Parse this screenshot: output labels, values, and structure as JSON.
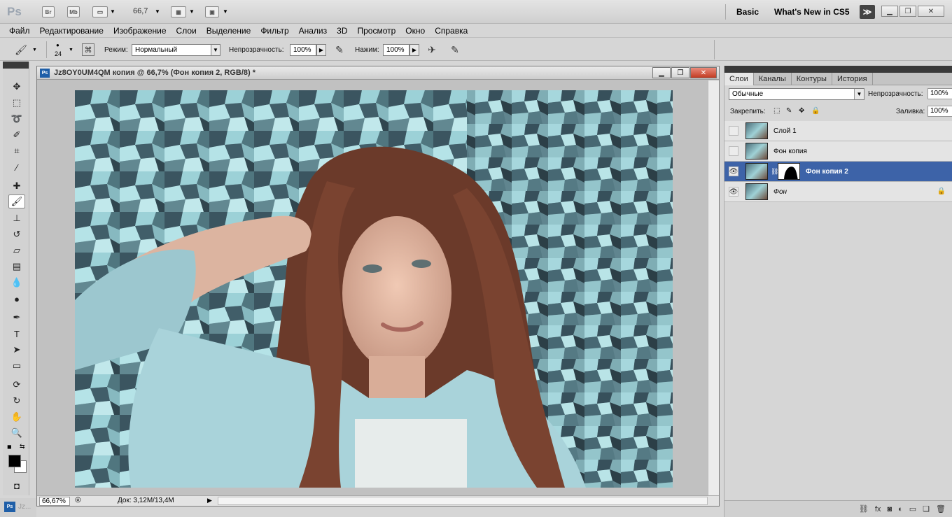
{
  "app": {
    "logo": "Ps",
    "br": "Br",
    "mb": "Mb",
    "zoom": "66,7",
    "workspace_basic": "Basic",
    "workspace_new": "What's New in CS5",
    "more": "≫"
  },
  "menu": [
    "Файл",
    "Редактирование",
    "Изображение",
    "Слои",
    "Выделение",
    "Фильтр",
    "Анализ",
    "3D",
    "Просмотр",
    "Окно",
    "Справка"
  ],
  "options": {
    "brush_size": "24",
    "mode_label": "Режим:",
    "mode_value": "Нормальный",
    "opacity_label": "Непрозрачность:",
    "opacity_value": "100%",
    "flow_label": "Нажим:",
    "flow_value": "100%"
  },
  "document": {
    "title": "Jz8OY0UM4QM копия @ 66,7% (Фон копия 2, RGB/8) *",
    "zoom": "66,67%",
    "doc_info": "Док: 3,12M/13,4M"
  },
  "layers_panel": {
    "tabs": [
      "Слои",
      "Каналы",
      "Контуры",
      "История"
    ],
    "blend_mode": "Обычные",
    "opacity_label": "Непрозрачность:",
    "opacity_value": "100%",
    "lock_label": "Закрепить:",
    "fill_label": "Заливка:",
    "fill_value": "100%",
    "layers": [
      {
        "name": "Слой 1",
        "visible": false,
        "selected": false
      },
      {
        "name": "Фон копия",
        "visible": false,
        "selected": false
      },
      {
        "name": "Фон копия 2",
        "visible": true,
        "selected": true,
        "has_mask": true
      },
      {
        "name": "Фон",
        "visible": true,
        "selected": false,
        "locked": true
      }
    ]
  },
  "taskbar": {
    "label": "Jz..."
  },
  "colors": {
    "selected_layer": "#3d63a8",
    "close_button": "#c23b22"
  }
}
